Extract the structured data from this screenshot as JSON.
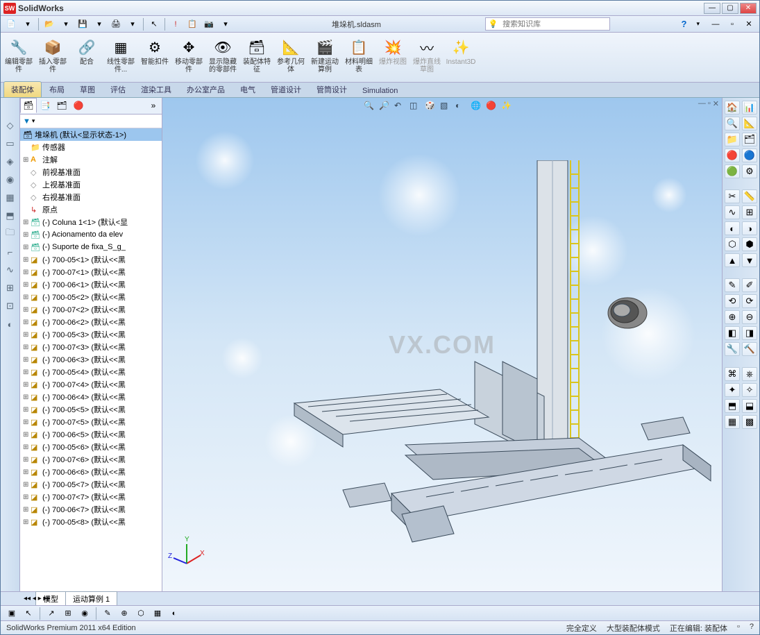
{
  "title": {
    "app": "SolidWorks"
  },
  "menubar": {
    "doc_name": "堆垛机.sldasm",
    "search_placeholder": "搜索知识库"
  },
  "ribbon": [
    {
      "label": "编辑零部件"
    },
    {
      "label": "插入零部件"
    },
    {
      "label": "配合"
    },
    {
      "label": "线性零部件..."
    },
    {
      "label": "智能扣件"
    },
    {
      "label": "移动零部件"
    },
    {
      "label": "显示隐藏的零部件"
    },
    {
      "label": "装配体特征"
    },
    {
      "label": "参考几何体"
    },
    {
      "label": "新建运动算例"
    },
    {
      "label": "材料明细表"
    },
    {
      "label": "爆炸视图"
    },
    {
      "label": "爆炸直线草图"
    },
    {
      "label": "Instant3D"
    }
  ],
  "tabs": [
    "装配体",
    "布局",
    "草图",
    "评估",
    "渲染工具",
    "办公室产品",
    "电气",
    "管道设计",
    "管筒设计",
    "Simulation"
  ],
  "tree": {
    "root": "堆垛机  (默认<显示状态-1>)",
    "items": [
      {
        "ico": "folder",
        "txt": "传感器"
      },
      {
        "ico": "A",
        "txt": "注解"
      },
      {
        "ico": "diamond",
        "txt": "前视基准面"
      },
      {
        "ico": "diamond",
        "txt": "上视基准面"
      },
      {
        "ico": "diamond",
        "txt": "右视基准面"
      },
      {
        "ico": "origin",
        "txt": "原点"
      },
      {
        "ico": "asm",
        "txt": "(-) Coluna 1<1> (默认<显"
      },
      {
        "ico": "asm",
        "txt": "(-) Acionamento da elev"
      },
      {
        "ico": "asm",
        "txt": "(-) Suporte de fixa_S_g_"
      },
      {
        "ico": "part",
        "txt": "(-) 700-05<1> (默认<<黑"
      },
      {
        "ico": "part",
        "txt": "(-) 700-07<1> (默认<<黑"
      },
      {
        "ico": "part",
        "txt": "(-) 700-06<1> (默认<<黑"
      },
      {
        "ico": "part",
        "txt": "(-) 700-05<2> (默认<<黑"
      },
      {
        "ico": "part",
        "txt": "(-) 700-07<2> (默认<<黑"
      },
      {
        "ico": "part",
        "txt": "(-) 700-06<2> (默认<<黑"
      },
      {
        "ico": "part",
        "txt": "(-) 700-05<3> (默认<<黑"
      },
      {
        "ico": "part",
        "txt": "(-) 700-07<3> (默认<<黑"
      },
      {
        "ico": "part",
        "txt": "(-) 700-06<3> (默认<<黑"
      },
      {
        "ico": "part",
        "txt": "(-) 700-05<4> (默认<<黑"
      },
      {
        "ico": "part",
        "txt": "(-) 700-07<4> (默认<<黑"
      },
      {
        "ico": "part",
        "txt": "(-) 700-06<4> (默认<<黑"
      },
      {
        "ico": "part",
        "txt": "(-) 700-05<5> (默认<<黑"
      },
      {
        "ico": "part",
        "txt": "(-) 700-07<5> (默认<<黑"
      },
      {
        "ico": "part",
        "txt": "(-) 700-06<5> (默认<<黑"
      },
      {
        "ico": "part",
        "txt": "(-) 700-05<6> (默认<<黑"
      },
      {
        "ico": "part",
        "txt": "(-) 700-07<6> (默认<<黑"
      },
      {
        "ico": "part",
        "txt": "(-) 700-06<6> (默认<<黑"
      },
      {
        "ico": "part",
        "txt": "(-) 700-05<7> (默认<<黑"
      },
      {
        "ico": "part",
        "txt": "(-) 700-07<7> (默认<<黑"
      },
      {
        "ico": "part",
        "txt": "(-) 700-06<7> (默认<<黑"
      },
      {
        "ico": "part",
        "txt": "(-) 700-05<8> (默认<<黑"
      }
    ]
  },
  "watermark": "VX.COM",
  "triad": {
    "x": "X",
    "y": "Y",
    "z": "Z"
  },
  "bottom_tabs": [
    "模型",
    "运动算例 1"
  ],
  "status": {
    "left": "SolidWorks Premium 2011 x64 Edition",
    "r1": "完全定义",
    "r2": "大型装配体模式",
    "r3": "正在编辑: 装配体"
  }
}
